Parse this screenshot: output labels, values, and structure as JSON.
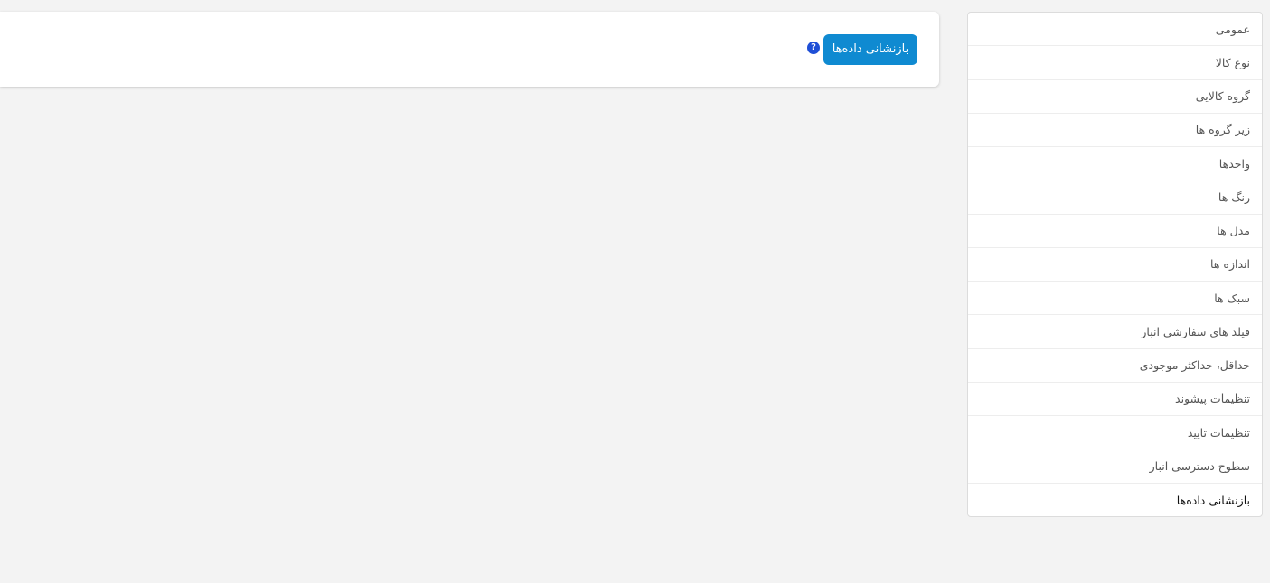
{
  "main": {
    "reset_button_label": "بازنشانی داده‌ها",
    "help_icon_glyph": "?"
  },
  "sidebar": {
    "items": [
      {
        "label": "عمومی"
      },
      {
        "label": "نوع کالا"
      },
      {
        "label": "گروه کالایی"
      },
      {
        "label": "زیر گروه ها"
      },
      {
        "label": "واحدها"
      },
      {
        "label": "رنگ ها"
      },
      {
        "label": "مدل ها"
      },
      {
        "label": "اندازه ها"
      },
      {
        "label": "سبک ها"
      },
      {
        "label": "فیلد های سفارشی انبار"
      },
      {
        "label": "حداقل، حداکثر موجودی"
      },
      {
        "label": "تنظیمات پیشوند"
      },
      {
        "label": "تنظیمات تایید"
      },
      {
        "label": "سطوح دسترسی انبار"
      },
      {
        "label": "بازنشانی داده‌ها"
      }
    ],
    "active_index": 14
  },
  "colors": {
    "accent": "#0f8ad1",
    "help_icon": "#1f4fd6",
    "background": "#f3f3f3"
  }
}
